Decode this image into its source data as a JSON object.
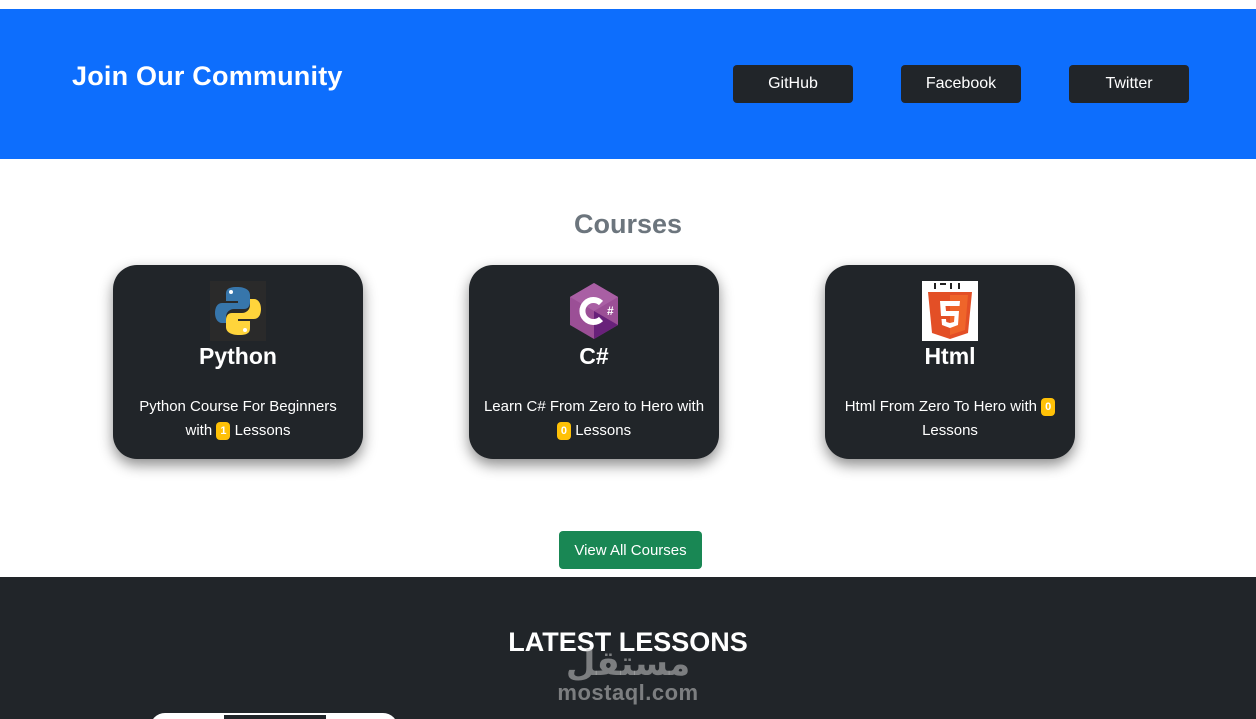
{
  "community": {
    "title": "Join Our Community",
    "buttons": [
      {
        "label": "GitHub"
      },
      {
        "label": "Facebook"
      },
      {
        "label": "Twitter"
      }
    ]
  },
  "courses": {
    "heading": "Courses",
    "items": [
      {
        "title": "Python",
        "icon": "python-logo-icon",
        "desc_before": "Python Course For Beginners with",
        "lessons": "1",
        "desc_after": "Lessons"
      },
      {
        "title": "C#",
        "icon": "csharp-logo-icon",
        "desc_before": "Learn C# From Zero to Hero with",
        "lessons": "0",
        "desc_after": "Lessons"
      },
      {
        "title": "Html",
        "icon": "html5-logo-icon",
        "desc_before": "Html From Zero To Hero with",
        "lessons": "0",
        "desc_after": "Lessons"
      }
    ],
    "view_all_label": "View All Courses"
  },
  "lessons": {
    "heading": "LATEST LESSONS"
  },
  "watermark": {
    "arabic": "مستقل",
    "latin": "mostaql.com"
  },
  "colors": {
    "primary": "#0d6efd",
    "dark": "#212529",
    "success": "#198754",
    "warning": "#ffc107",
    "muted": "#6c757d"
  }
}
